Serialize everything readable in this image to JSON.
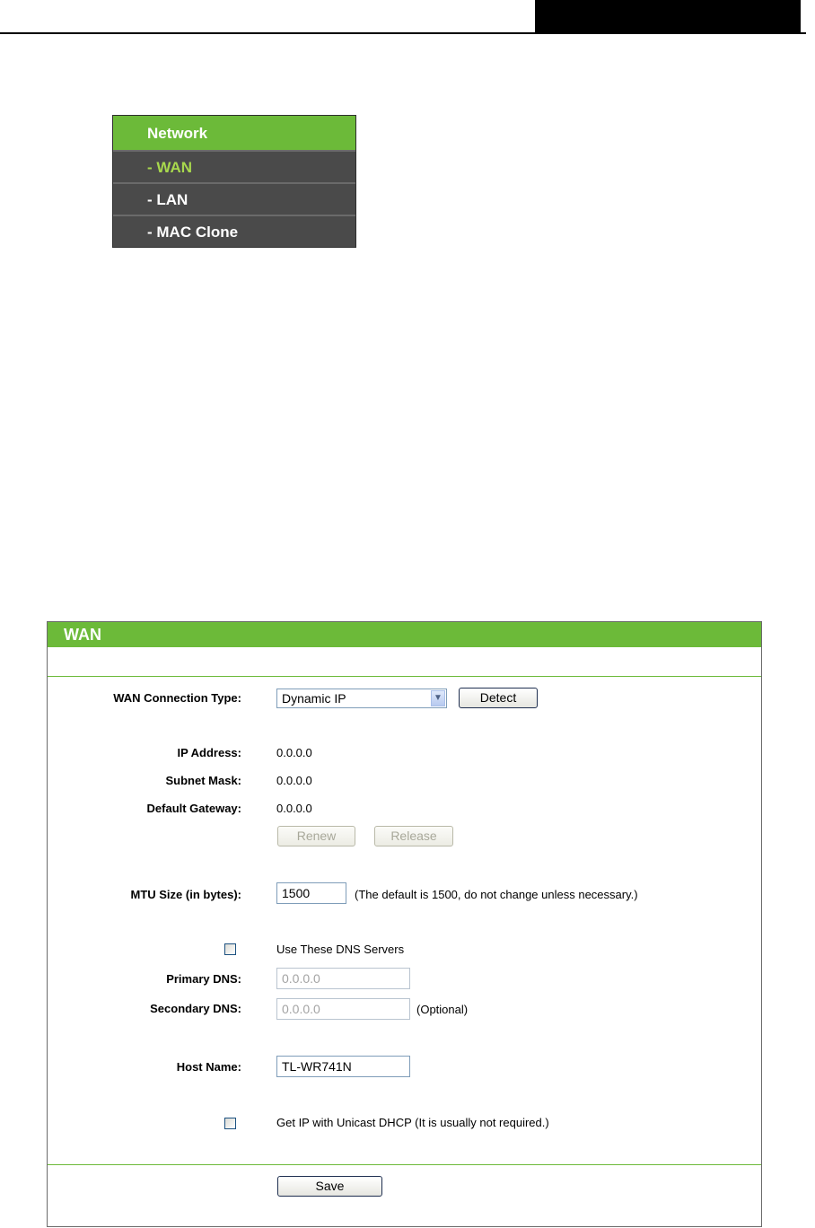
{
  "menu": {
    "header": "Network",
    "items": [
      {
        "label": "- WAN",
        "active": true
      },
      {
        "label": "- LAN",
        "active": false
      },
      {
        "label": "- MAC Clone",
        "active": false
      }
    ]
  },
  "panel": {
    "title": "WAN",
    "wan_connection_type": {
      "label": "WAN Connection Type:",
      "selected": "Dynamic IP"
    },
    "detect_label": "Detect",
    "ip_address": {
      "label": "IP Address:",
      "value": "0.0.0.0"
    },
    "subnet_mask": {
      "label": "Subnet Mask:",
      "value": "0.0.0.0"
    },
    "default_gateway": {
      "label": "Default Gateway:",
      "value": "0.0.0.0"
    },
    "renew_label": "Renew",
    "release_label": "Release",
    "mtu": {
      "label": "MTU Size (in bytes):",
      "value": "1500",
      "note": "(The default is 1500, do not change unless necessary.)"
    },
    "use_dns": {
      "label": "Use These DNS Servers",
      "checked": false
    },
    "primary_dns": {
      "label": "Primary DNS:",
      "value": "0.0.0.0"
    },
    "secondary_dns": {
      "label": "Secondary DNS:",
      "value": "0.0.0.0",
      "note": "(Optional)"
    },
    "host_name": {
      "label": "Host Name:",
      "value": "TL-WR741N"
    },
    "unicast_dhcp": {
      "label": "Get IP with Unicast DHCP (It is usually not required.)",
      "checked": false
    },
    "save_label": "Save"
  },
  "colors": {
    "accent_green": "#6cba39",
    "menu_bg": "#4a4a4a",
    "menu_active_text": "#a8d84d"
  }
}
